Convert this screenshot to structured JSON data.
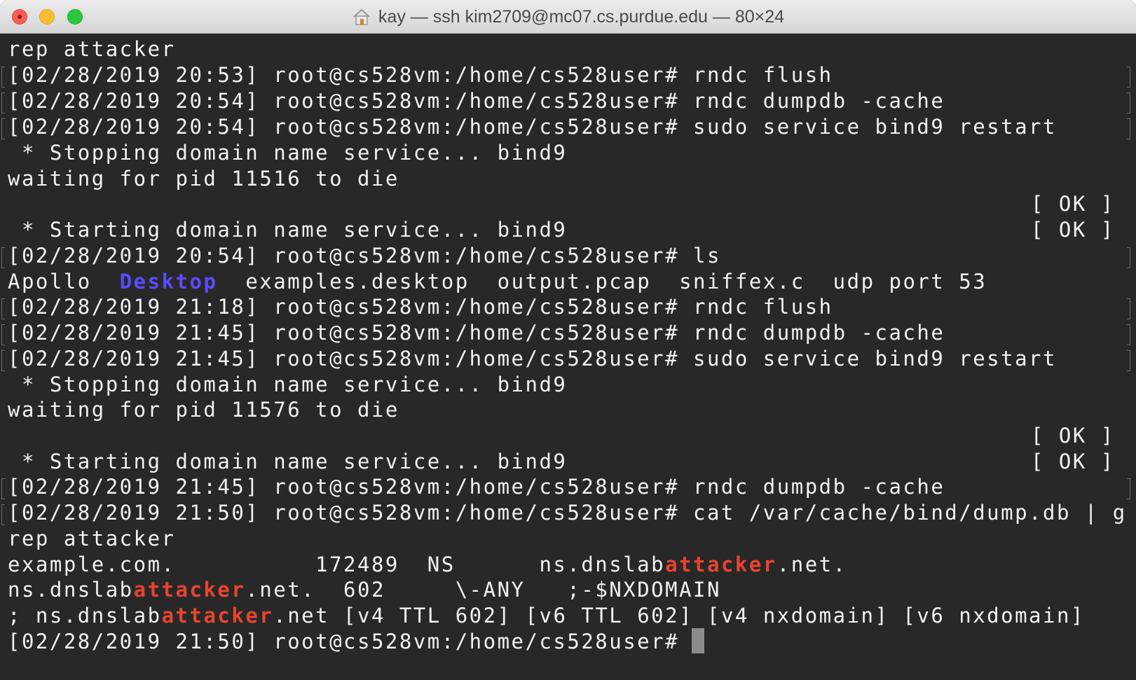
{
  "window": {
    "title": "kay — ssh kim2709@mc07.cs.purdue.edu — 80×24"
  },
  "terminal": {
    "l0": "rep attacker",
    "l1": "[02/28/2019 20:53] root@cs528vm:/home/cs528user# rndc flush",
    "l2": "[02/28/2019 20:54] root@cs528vm:/home/cs528user# rndc dumpdb -cache",
    "l3": "[02/28/2019 20:54] root@cs528vm:/home/cs528user# sudo service bind9 restart",
    "l4": " * Stopping domain name service... bind9",
    "l5": "waiting for pid 11516 to die",
    "l6_ok": "[ OK ]",
    "l7": " * Starting domain name service... bind9",
    "l7_ok": "[ OK ]",
    "l8": "[02/28/2019 20:54] root@cs528vm:/home/cs528user# ls",
    "ls": {
      "apollo": "Apollo",
      "desktop": "Desktop",
      "examples": "examples.desktop",
      "pcap": "output.pcap",
      "sniffex": "sniffex.c",
      "udp": "udp port 53"
    },
    "l10": "[02/28/2019 21:18] root@cs528vm:/home/cs528user# rndc flush",
    "l11": "[02/28/2019 21:45] root@cs528vm:/home/cs528user# rndc dumpdb -cache",
    "l12": "[02/28/2019 21:45] root@cs528vm:/home/cs528user# sudo service bind9 restart",
    "l13": " * Stopping domain name service... bind9",
    "l14": "waiting for pid 11576 to die",
    "l15_ok": "[ OK ]",
    "l16": " * Starting domain name service... bind9",
    "l16_ok": "[ OK ]",
    "l17": "[02/28/2019 21:45] root@cs528vm:/home/cs528user# rndc dumpdb -cache",
    "l18": "[02/28/2019 21:50] root@cs528vm:/home/cs528user# cat /var/cache/bind/dump.db | g",
    "l19": "rep attacker",
    "l20a": "example.com.          172489  NS      ns.dnslab",
    "l20b": "attacker",
    "l20c": ".net.",
    "l21a": "ns.dnslab",
    "l21b": "attacker",
    "l21c": ".net.  602     \\-ANY   ;-$NXDOMAIN",
    "l22a": "; ns.dnslab",
    "l22b": "attacker",
    "l22c": ".net [v4 TTL 602] [v6 TTL 602] [v4 nxdomain] [v6 nxdomain]",
    "prompt": "[02/28/2019 21:50] root@cs528vm:/home/cs528user#"
  },
  "colors": {
    "background": "#282828",
    "text": "#f2f2f2",
    "directory": "#5b4bff",
    "highlight": "#e8442f"
  }
}
